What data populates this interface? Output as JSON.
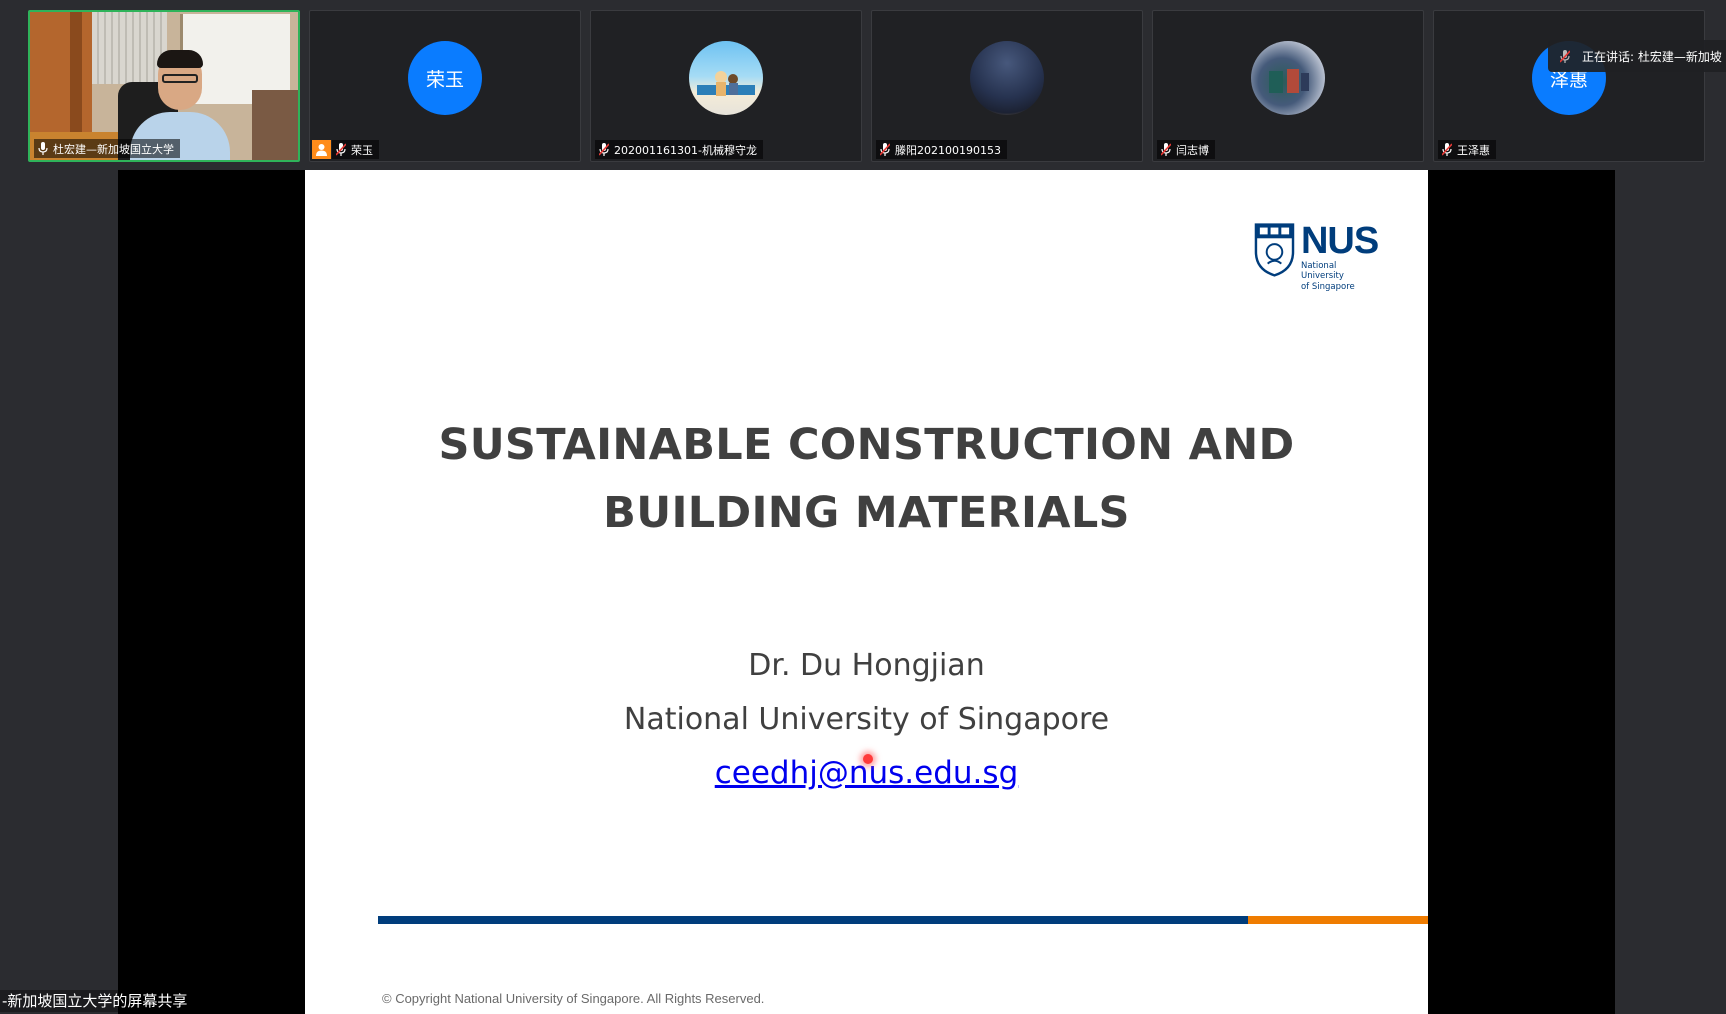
{
  "participants": [
    {
      "name": "杜宏建—新加坡国立大学",
      "avatar_text": "",
      "active": true,
      "mic": "on"
    },
    {
      "name": "荣玉",
      "avatar_text": "荣玉",
      "active": false,
      "mic": "muted",
      "host": true
    },
    {
      "name": "202001161301-机械穆守龙",
      "avatar_text": "",
      "active": false,
      "mic": "muted"
    },
    {
      "name": "滕阳202100190153",
      "avatar_text": "",
      "active": false,
      "mic": "muted"
    },
    {
      "name": "闫志博",
      "avatar_text": "",
      "active": false,
      "mic": "muted"
    },
    {
      "name": "王泽惠",
      "avatar_text": "泽惠",
      "active": false,
      "mic": "muted"
    }
  ],
  "speaking_indicator": "正在讲话: 杜宏建—新加坡",
  "slide": {
    "logo_word": "NUS",
    "logo_sub_1": "National University",
    "logo_sub_2": "of Singapore",
    "title_line_1": "SUSTAINABLE CONSTRUCTION AND",
    "title_line_2": "BUILDING MATERIALS",
    "author": "Dr. Du Hongjian",
    "affiliation": "National University of Singapore",
    "email": "ceedhj@nus.edu.sg",
    "copyright": "© Copyright National University of Singapore. All Rights Reserved."
  },
  "share_caption": "-新加坡国立大学的屏幕共享",
  "colors": {
    "avatar_blue": "#0a7cff",
    "active_border": "#2fb35a",
    "nus_blue": "#003d7c",
    "nus_orange": "#ef7c00",
    "host_badge": "#ff8c1a"
  }
}
